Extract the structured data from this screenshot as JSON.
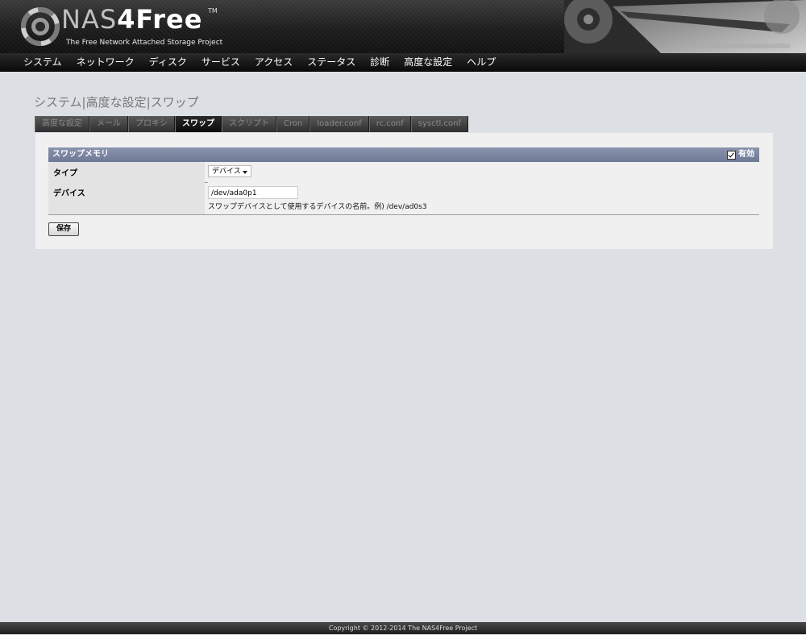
{
  "header": {
    "brand_prefix": "NAS",
    "brand_suffix": "4Free",
    "trademark": "TM",
    "tagline": "The Free Network Attached Storage Project"
  },
  "nav": {
    "items": [
      "システム",
      "ネットワーク",
      "ディスク",
      "サービス",
      "アクセス",
      "ステータス",
      "診断",
      "高度な設定",
      "ヘルプ"
    ]
  },
  "page": {
    "title": "システム|高度な設定|スワップ"
  },
  "tabs": [
    {
      "label": "高度な設定",
      "active": false
    },
    {
      "label": "メール",
      "active": false
    },
    {
      "label": "プロキシ",
      "active": false
    },
    {
      "label": "スワップ",
      "active": true
    },
    {
      "label": "スクリプト",
      "active": false
    },
    {
      "label": "Cron",
      "active": false
    },
    {
      "label": "loader.conf",
      "active": false
    },
    {
      "label": "rc.conf",
      "active": false
    },
    {
      "label": "sysctl.conf",
      "active": false
    }
  ],
  "section": {
    "title": "スワップメモリ",
    "enable_label": "有効",
    "enable_checked": true
  },
  "form": {
    "type_label": "タイプ",
    "type_value": "デバイス",
    "device_label": "デバイス",
    "device_value": "/dev/ada0p1",
    "device_hint": "スワップデバイスとして使用するデバイスの名前。例) /dev/ad0s3",
    "save_label": "保存"
  },
  "footer": {
    "text": "Copyright © 2012-2014 The NAS4Free Project"
  }
}
